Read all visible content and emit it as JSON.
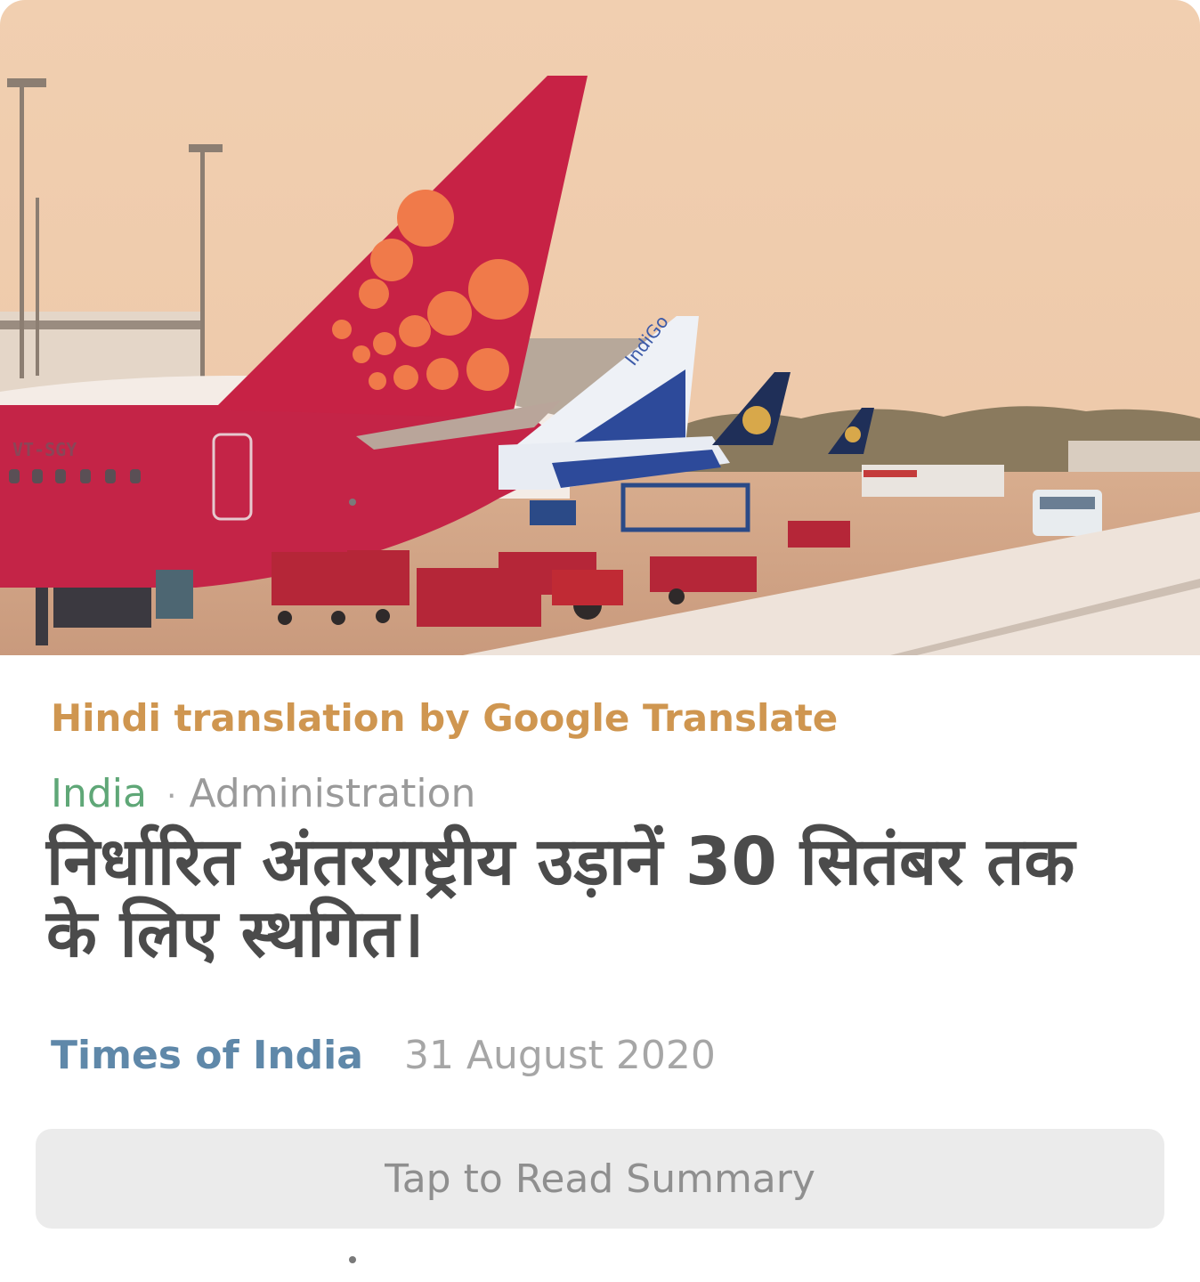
{
  "hero": {
    "tail_registration": "VT-SGY",
    "second_tail_text": "IndiGo"
  },
  "article": {
    "translation_note": "Hindi translation by Google Translate",
    "region": "India",
    "separator": "·",
    "category": "Administration",
    "headline": "निर्धारित अंतरराष्ट्रीय उड़ानें 30 सितंबर तक के लिए स्थगित।",
    "source": "Times of India",
    "date": "31 August 2020"
  },
  "actions": {
    "read_summary_label": "Tap to Read Summary"
  },
  "colors": {
    "translation_note": "#cf9650",
    "region": "#5fa777",
    "source": "#5f88a9",
    "headline": "#4b4b4b",
    "button_bg": "#ebebeb"
  }
}
